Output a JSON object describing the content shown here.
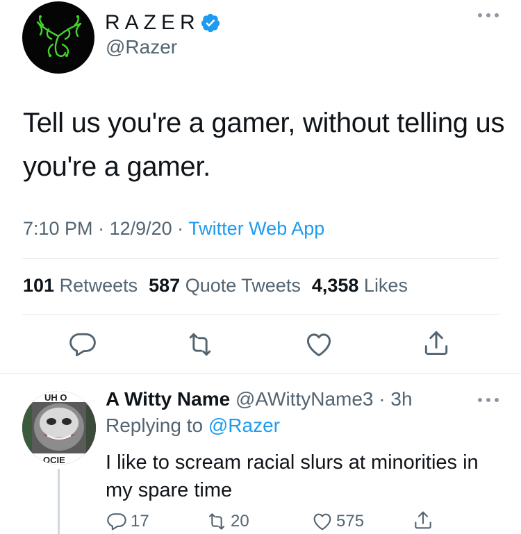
{
  "tweet": {
    "display_name": "RAZER",
    "handle": "@Razer",
    "text": "Tell us you're a gamer, without telling us you're a gamer.",
    "time": "7:10 PM",
    "sep1": " · ",
    "date": "12/9/20",
    "sep2": " · ",
    "app": "Twitter Web App",
    "stats": {
      "retweets_count": "101",
      "retweets_label": "Retweets",
      "quotes_count": "587",
      "quotes_label": "Quote Tweets",
      "likes_count": "4,358",
      "likes_label": "Likes"
    },
    "icons": [
      "reply-icon",
      "retweet-icon",
      "like-icon",
      "share-icon"
    ]
  },
  "reply": {
    "display_name": "A Witty Name",
    "handle": "@AWittyName3",
    "sep": " · ",
    "age": "3h",
    "replying_prefix": "Replying to ",
    "replying_to": "@Razer",
    "text": "I like to scream racial slurs at minorities in my spare time",
    "reply_count": "17",
    "retweet_count": "20",
    "like_count": "575",
    "avatar_text_top": "UH O",
    "avatar_text_bottom": "OCIE"
  },
  "colors": {
    "accent": "#1d9bf0",
    "secondary_text": "#536471",
    "primary_text": "#0f1419",
    "razer_green": "#44d62c"
  }
}
